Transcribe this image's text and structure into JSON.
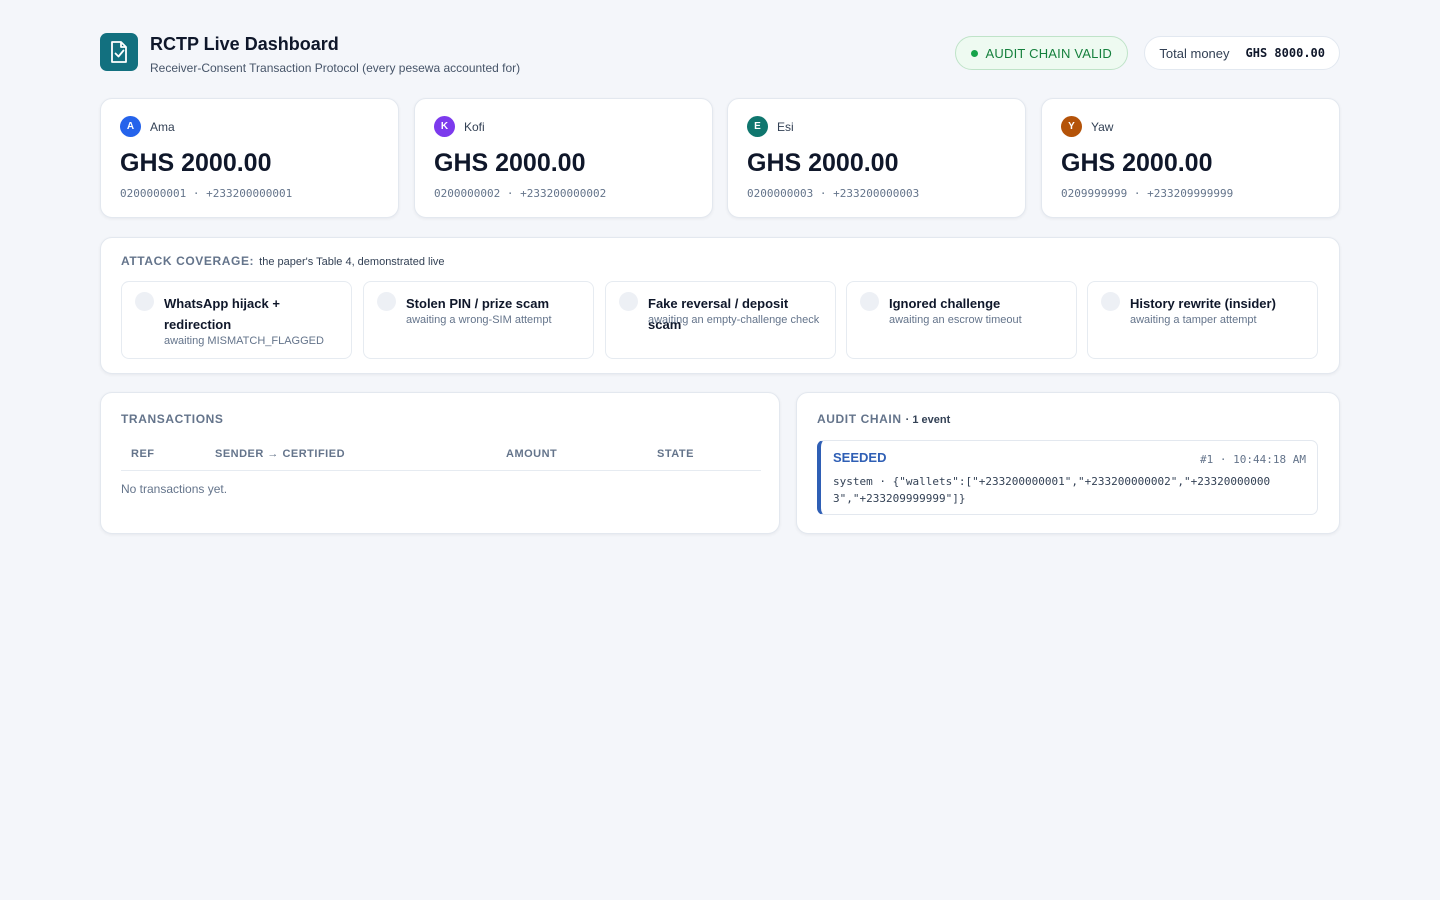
{
  "header": {
    "title": "RCTP Live Dashboard",
    "subtitle": "Receiver-Consent Transaction Protocol (every pesewa accounted for)",
    "audit_status": "AUDIT CHAIN VALID",
    "total_label": "Total money",
    "total_value": "GHS 8000.00",
    "icon": "document-check-icon"
  },
  "wallets": [
    {
      "initial": "A",
      "name": "Ama",
      "balance": "GHS 2000.00",
      "ids": "0200000001 · +233200000001",
      "color": "#2563eb"
    },
    {
      "initial": "K",
      "name": "Kofi",
      "balance": "GHS 2000.00",
      "ids": "0200000002 · +233200000002",
      "color": "#7c3aed"
    },
    {
      "initial": "E",
      "name": "Esi",
      "balance": "GHS 2000.00",
      "ids": "0200000003 · +233200000003",
      "color": "#0f766e"
    },
    {
      "initial": "Y",
      "name": "Yaw",
      "balance": "GHS 2000.00",
      "ids": "0209999999 · +233209999999",
      "color": "#b45309"
    }
  ],
  "attack_coverage": {
    "label": "ATTACK COVERAGE:",
    "note": "the paper's Table 4, demonstrated live",
    "items": [
      {
        "name": "WhatsApp hijack + redirection",
        "status": "awaiting MISMATCH_FLAGGED"
      },
      {
        "name": "Stolen PIN / prize scam",
        "status": "awaiting a wrong-SIM attempt"
      },
      {
        "name": "Fake reversal / deposit scam",
        "status": "awaiting an empty-challenge check"
      },
      {
        "name": "Ignored challenge",
        "status": "awaiting an escrow timeout"
      },
      {
        "name": "History rewrite (insider)",
        "status": "awaiting a tamper attempt"
      }
    ]
  },
  "transactions": {
    "label": "TRANSACTIONS",
    "columns": [
      "REF",
      "SENDER → CERTIFIED",
      "AMOUNT",
      "STATE"
    ],
    "empty": "No transactions yet."
  },
  "audit_chain": {
    "label": "AUDIT CHAIN",
    "count": "· 1 event",
    "events": [
      {
        "type": "SEEDED",
        "meta": "#1 · 10:44:18 AM",
        "body": "system · {\"wallets\":[\"+233200000001\",\"+233200000002\",\"+233200000003\",\"+233209999999\"]}"
      }
    ]
  },
  "colors": {
    "brand": "#12707f",
    "valid_green": "#16a34a",
    "event_blue": "#2f5fb5",
    "background": "#f4f6fa"
  }
}
